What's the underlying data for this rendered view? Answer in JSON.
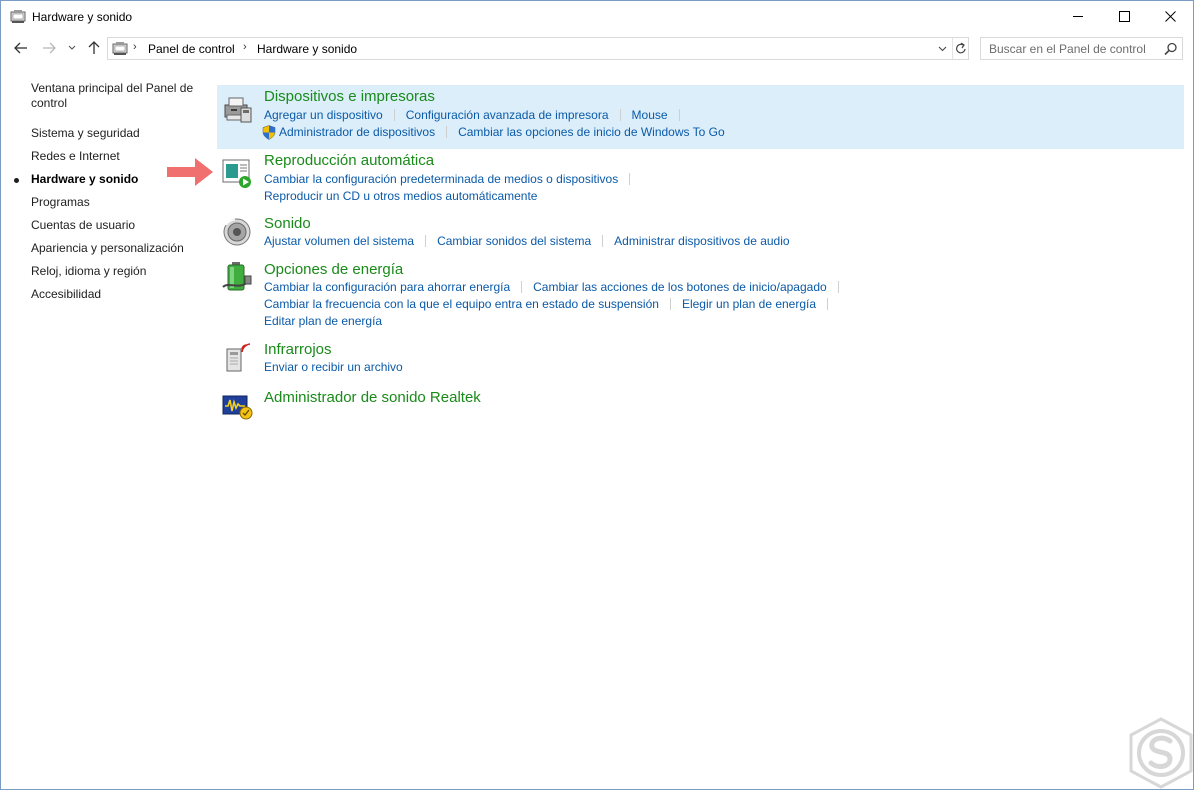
{
  "window": {
    "title": "Hardware y sonido",
    "minimize_icon": "minimize-icon",
    "maximize_icon": "maximize-icon",
    "close_icon": "close-icon"
  },
  "address_bar": {
    "breadcrumbs": [
      "Panel de control",
      "Hardware y sonido"
    ],
    "search_placeholder": "Buscar en el Panel de control"
  },
  "left_nav": {
    "items": [
      {
        "label": "Ventana principal del Panel de control",
        "active": false
      },
      {
        "label": "Sistema y seguridad",
        "active": false
      },
      {
        "label": "Redes e Internet",
        "active": false
      },
      {
        "label": "Hardware y sonido",
        "active": true
      },
      {
        "label": "Programas",
        "active": false
      },
      {
        "label": "Cuentas de usuario",
        "active": false
      },
      {
        "label": "Apariencia y personalización",
        "active": false
      },
      {
        "label": "Reloj, idioma y región",
        "active": false
      },
      {
        "label": "Accesibilidad",
        "active": false
      }
    ]
  },
  "sections": [
    {
      "title": "Dispositivos e impresoras",
      "icon": "printer-icon",
      "highlighted": true,
      "rows": [
        [
          "Agregar un dispositivo",
          "Configuración avanzada de impresora",
          "Mouse"
        ],
        [
          "Administrador de dispositivos",
          "Cambiar las opciones de inicio de Windows To Go"
        ]
      ]
    },
    {
      "title": "Reproducción automática",
      "icon": "autoplay-icon",
      "rows": [
        [
          "Cambiar la configuración predeterminada de medios o dispositivos"
        ],
        [
          "Reproducir un CD u otros medios automáticamente"
        ]
      ]
    },
    {
      "title": "Sonido",
      "icon": "speaker-icon",
      "rows": [
        [
          "Ajustar volumen del sistema",
          "Cambiar sonidos del sistema",
          "Administrar dispositivos de audio"
        ]
      ]
    },
    {
      "title": "Opciones de energía",
      "icon": "battery-icon",
      "rows": [
        [
          "Cambiar la configuración para ahorrar energía",
          "Cambiar las acciones de los botones de inicio/apagado"
        ],
        [
          "Cambiar la frecuencia con la que el equipo entra en estado de suspensión",
          "Elegir un plan de energía"
        ],
        [
          "Editar plan de energía"
        ]
      ]
    },
    {
      "title": "Infrarrojos",
      "icon": "infrared-icon",
      "rows": [
        [
          "Enviar o recibir un archivo"
        ]
      ]
    },
    {
      "title": "Administrador de sonido Realtek",
      "icon": "realtek-icon",
      "rows": []
    }
  ],
  "colors": {
    "heading": "#1a8a1a",
    "link": "#0b5aa8",
    "highlight_bg": "#dbeefa",
    "arrow": "#f07070"
  }
}
